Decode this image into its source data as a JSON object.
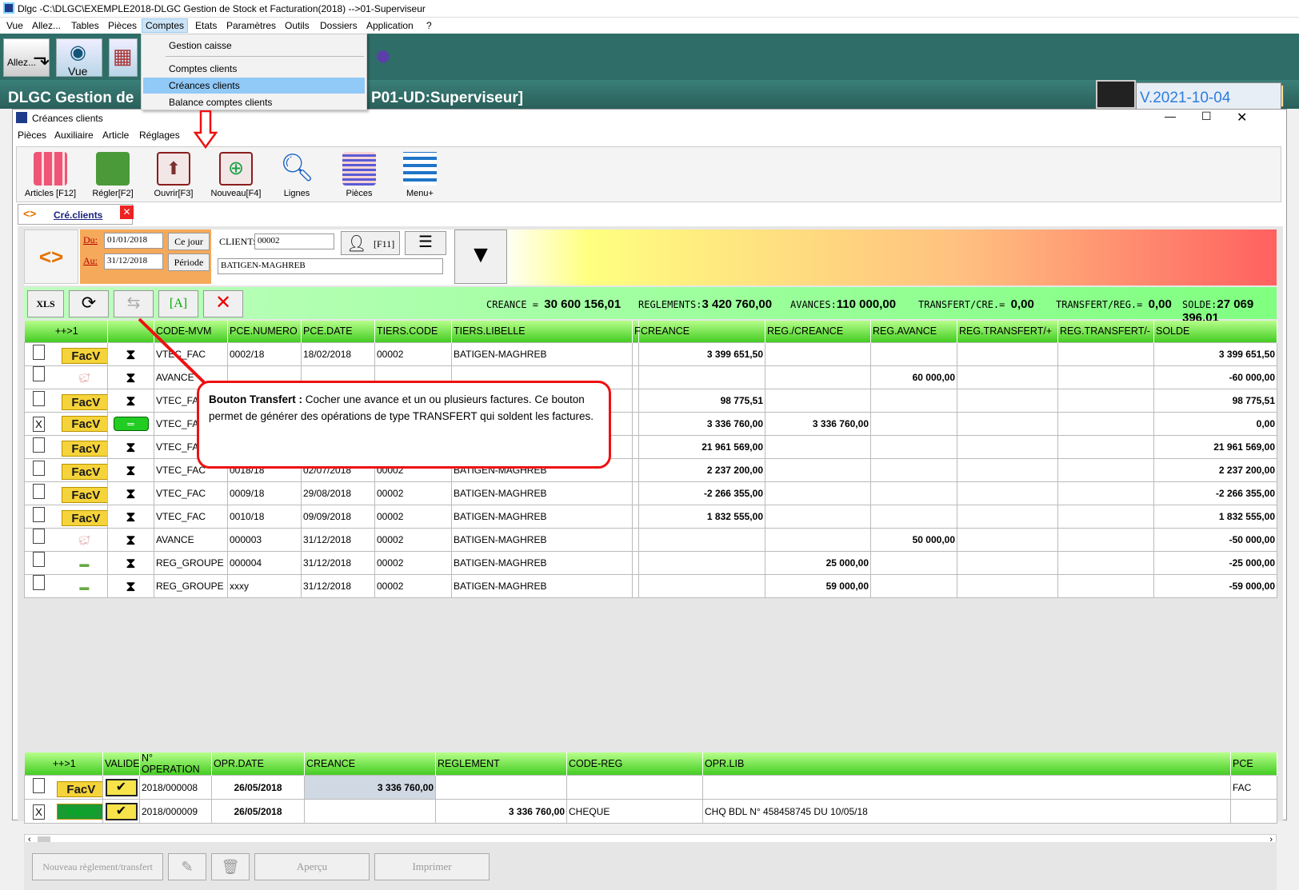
{
  "window": {
    "title": "Dlgc -C:\\DLGC\\EXEMPLE2018-DLGC Gestion de Stock et Facturation(2018) -->01-Superviseur"
  },
  "menu": {
    "items": [
      "Vue",
      "Allez...",
      "Tables",
      "Pièces",
      "Comptes",
      "Etats",
      "Paramètres",
      "Outils",
      "Dossiers",
      "Application",
      "?"
    ]
  },
  "dropdown": {
    "items": [
      "Gestion caisse",
      "Comptes clients",
      "Créances clients",
      "Balance comptes clients"
    ]
  },
  "toolbar1": {
    "allez": "Allez...",
    "vue": "Vue"
  },
  "header": {
    "title": "DLGC Gestion de",
    "user": "P01-UD:Superviseur]",
    "version": "V.2021-10-04"
  },
  "child": {
    "title": "Créances clients",
    "menu": [
      "Pièces",
      "Auxiliaire",
      "Article",
      "Réglages"
    ]
  },
  "toolbar2": [
    {
      "label": "Articles [F12]"
    },
    {
      "label": "Régler[F2]"
    },
    {
      "label": "Ouvrir[F3]"
    },
    {
      "label": "Nouveau[F4]"
    },
    {
      "label": "Lignes"
    },
    {
      "label": "Pièces"
    },
    {
      "label": "Menu+"
    }
  ],
  "tab": {
    "label": "Cré.clients"
  },
  "filter": {
    "du_label": "Du:",
    "du": "01/01/2018",
    "au_label": "Au:",
    "au": "31/12/2018",
    "cejour": "Ce jour",
    "periode": "Période",
    "client_label": "CLIENT:",
    "client": "00002",
    "f11": "[F11]",
    "client_name": "BATIGEN-MAGHREB"
  },
  "totals": {
    "creance_label": "CREANCE =",
    "creance": "30 600 156,01",
    "reg_label": "REGLEMENTS:",
    "reg": "3 420 760,00",
    "avances_label": "AVANCES:",
    "avances": "110 000,00",
    "tcre_label": "TRANSFERT/CRE.=",
    "tcre": "0,00",
    "treg_label": "TRANSFERT/REG.=",
    "treg": "0,00",
    "solde_label": "SOLDE:",
    "solde": "27 069 396,01"
  },
  "grid1": {
    "headers": [
      "++>1",
      "",
      "CODE-MVM",
      "PCE.NUMERO",
      "PCE.DATE",
      "TIERS.CODE",
      "TIERS.LIBELLE",
      "F",
      "CREANCE",
      "REG./CREANCE",
      "REG.AVANCE",
      "REG.TRANSFERT/+",
      "REG.TRANSFERT/-",
      "SOLDE"
    ],
    "rows": [
      {
        "chk": "",
        "type": "FacV",
        "code": "VTEC_FAC",
        "num": "0002/18",
        "date": "18/02/2018",
        "tiers": "00002",
        "lib": "BATIGEN-MAGHREB",
        "creance": "3 399 651,50",
        "regc": "",
        "rega": "",
        "solde": "3 399 651,50"
      },
      {
        "chk": "",
        "type": "avance",
        "code": "AVANCE",
        "num": "",
        "date": "",
        "tiers": "",
        "lib": "",
        "creance": "",
        "regc": "",
        "rega": "60 000,00",
        "solde": "-60 000,00"
      },
      {
        "chk": "",
        "type": "FacV",
        "code": "VTEC_FAC",
        "num": "",
        "date": "",
        "tiers": "",
        "lib": "",
        "creance": "98 775,51",
        "regc": "",
        "rega": "",
        "solde": "98 775,51"
      },
      {
        "chk": "X",
        "type": "FacV",
        "code": "VTEC_FAC",
        "num": "",
        "date": "",
        "tiers": "",
        "lib": "",
        "creance": "3 336 760,00",
        "regc": "3 336 760,00",
        "rega": "",
        "solde": "0,00"
      },
      {
        "chk": "",
        "type": "FacV",
        "code": "VTEC_FAC",
        "num": "",
        "date": "",
        "tiers": "",
        "lib": "",
        "creance": "21 961 569,00",
        "regc": "",
        "rega": "",
        "solde": "21 961 569,00"
      },
      {
        "chk": "",
        "type": "FacV",
        "code": "VTEC_FAC",
        "num": "0018/18",
        "date": "02/07/2018",
        "tiers": "00002",
        "lib": "BATIGEN-MAGHREB",
        "creance": "2 237 200,00",
        "regc": "",
        "rega": "",
        "solde": "2 237 200,00"
      },
      {
        "chk": "",
        "type": "FacV",
        "code": "VTEC_FAC",
        "num": "0009/18",
        "date": "29/08/2018",
        "tiers": "00002",
        "lib": "BATIGEN-MAGHREB",
        "creance": "-2 266 355,00",
        "regc": "",
        "rega": "",
        "solde": "-2 266 355,00"
      },
      {
        "chk": "",
        "type": "FacV",
        "code": "VTEC_FAC",
        "num": "0010/18",
        "date": "09/09/2018",
        "tiers": "00002",
        "lib": "BATIGEN-MAGHREB",
        "creance": "1 832 555,00",
        "regc": "",
        "rega": "",
        "solde": "1 832 555,00"
      },
      {
        "chk": "",
        "type": "avance",
        "code": "AVANCE",
        "num": "000003",
        "date": "31/12/2018",
        "tiers": "00002",
        "lib": "BATIGEN-MAGHREB",
        "creance": "",
        "regc": "",
        "rega": "50 000,00",
        "solde": "-50 000,00"
      },
      {
        "chk": "",
        "type": "groupe",
        "code": "REG_GROUPE",
        "num": "000004",
        "date": "31/12/2018",
        "tiers": "00002",
        "lib": "BATIGEN-MAGHREB",
        "creance": "",
        "regc": "25 000,00",
        "rega": "",
        "solde": "-25 000,00"
      },
      {
        "chk": "",
        "type": "groupe",
        "code": "REG_GROUPE",
        "num": "xxxy",
        "date": "31/12/2018",
        "tiers": "00002",
        "lib": "BATIGEN-MAGHREB",
        "creance": "",
        "regc": "59 000,00",
        "rega": "",
        "solde": "-59 000,00"
      }
    ]
  },
  "grid2": {
    "headers": [
      "++>1",
      "VALIDE",
      "N° OPERATION",
      "OPR.DATE",
      "CREANCE",
      "REGLEMENT",
      "CODE-REG",
      "OPR.LIB",
      "PCE"
    ],
    "rows": [
      {
        "chk": "",
        "op": "2018/000008",
        "date": "26/05/2018",
        "creance": "3 336 760,00",
        "reg": "",
        "code": "",
        "lib": "",
        "pce": "FAC"
      },
      {
        "chk": "X",
        "op": "2018/000009",
        "date": "26/05/2018",
        "creance": "",
        "reg": "3 336 760,00",
        "code": "CHEQUE",
        "lib": "CHQ BDL N° 458458745 DU 10/05/18",
        "pce": ""
      }
    ]
  },
  "bottom": {
    "nouveau": "Nouveau règlement/transfert",
    "apercu": "Aperçu",
    "imprimer": "Imprimer"
  },
  "callout": {
    "title": "Bouton Transfert :",
    "text": "Cocher une avance et un ou plusieurs factures.  Ce bouton permet de  générer des opérations de type TRANSFERT qui soldent les factures."
  },
  "colors": {
    "accent_red": "#e11111",
    "grid_header": "#44cc22",
    "selected_op": "#00ffff"
  }
}
